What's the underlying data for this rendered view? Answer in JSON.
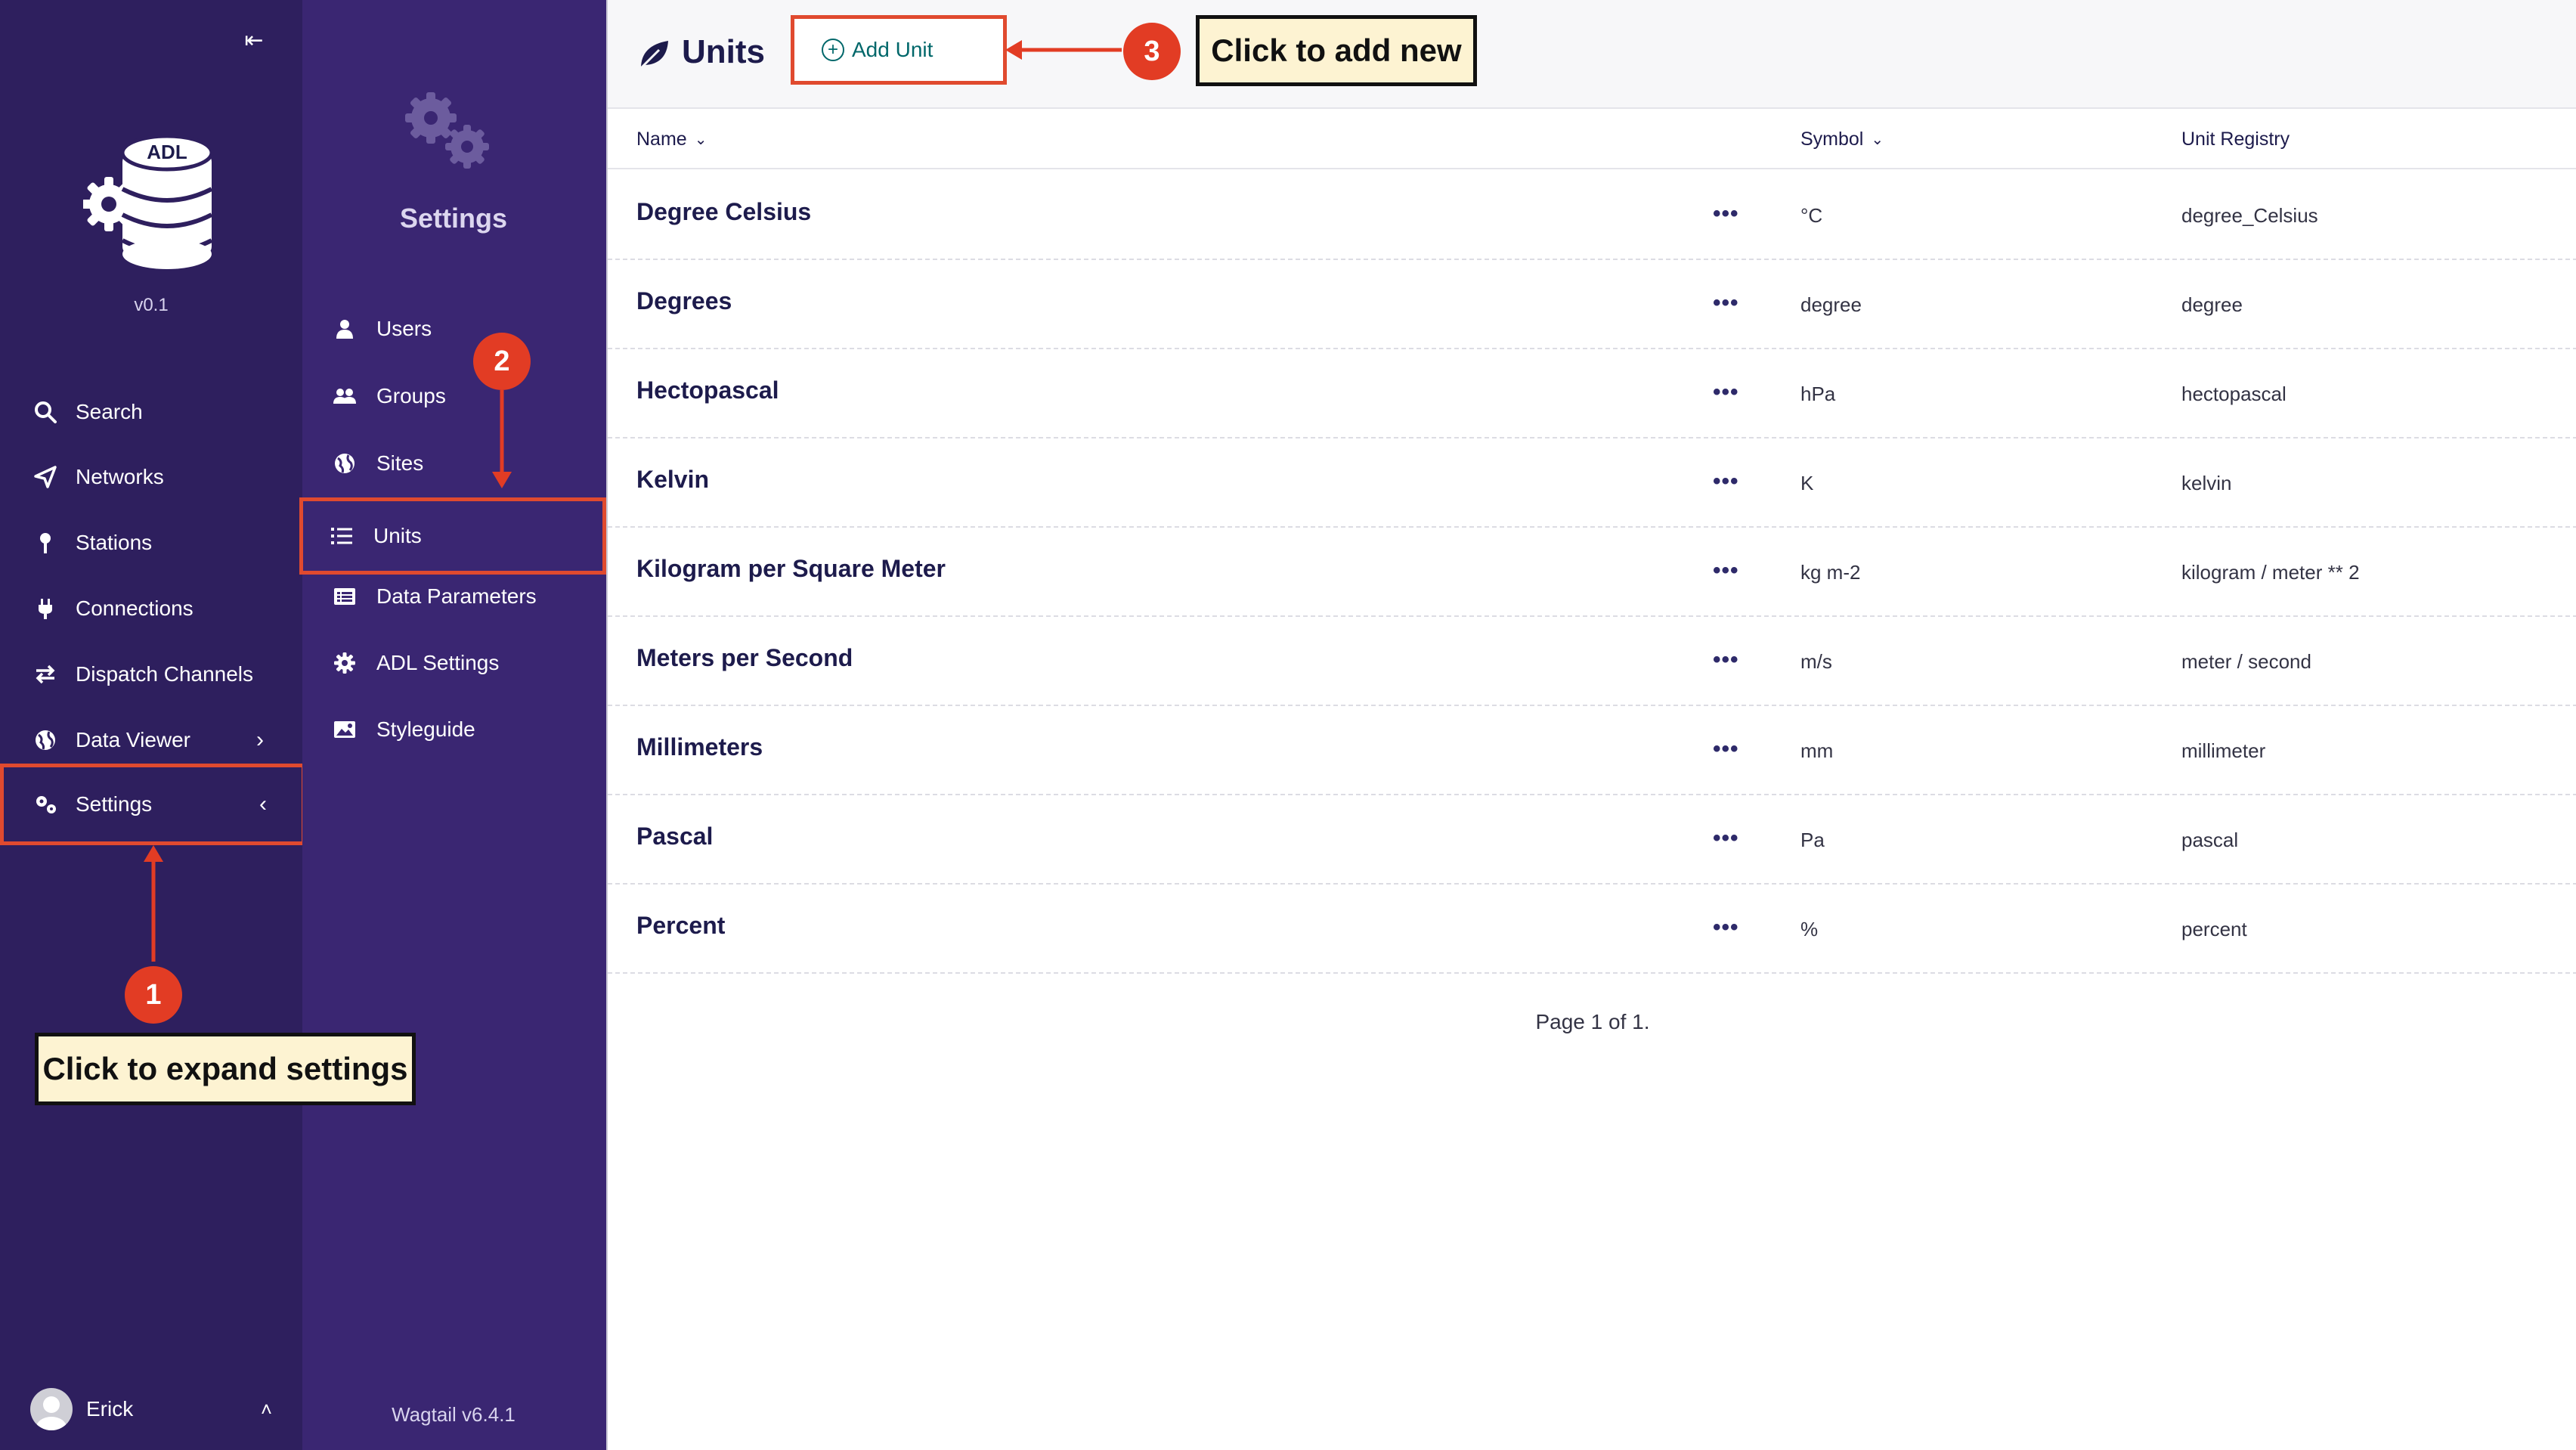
{
  "sidebar": {
    "collapse_label": "⇤",
    "logo_text": "ADL",
    "version": "v0.1",
    "items": [
      {
        "label": "Search",
        "icon": "search-icon"
      },
      {
        "label": "Networks",
        "icon": "paper-plane-icon"
      },
      {
        "label": "Stations",
        "icon": "pin-icon"
      },
      {
        "label": "Connections",
        "icon": "plug-icon"
      },
      {
        "label": "Dispatch Channels",
        "icon": "swap-icon"
      },
      {
        "label": "Data Viewer",
        "icon": "globe-icon",
        "chevron": "›"
      },
      {
        "label": "Settings",
        "icon": "cogs-icon",
        "chevron": "‹"
      }
    ],
    "user": {
      "name": "Erick",
      "chevron": "˄"
    }
  },
  "settings_panel": {
    "title": "Settings",
    "items": [
      {
        "label": "Users",
        "icon": "user-icon"
      },
      {
        "label": "Groups",
        "icon": "group-icon"
      },
      {
        "label": "Sites",
        "icon": "globe-icon"
      },
      {
        "label": "Units",
        "icon": "list-icon"
      },
      {
        "label": "Data Parameters",
        "icon": "table-icon"
      },
      {
        "label": "ADL Settings",
        "icon": "gear-icon"
      },
      {
        "label": "Styleguide",
        "icon": "image-icon"
      }
    ],
    "footer": "Wagtail v6.4.1"
  },
  "header": {
    "title": "Units",
    "add_button": {
      "icon": "+",
      "label": "Add Unit"
    }
  },
  "table": {
    "columns": [
      {
        "label": "Name",
        "sort_icon": "⌄"
      },
      {
        "label": "Symbol",
        "sort_icon": "⌄"
      },
      {
        "label": "Unit Registry"
      }
    ],
    "more_label": "•••",
    "rows": [
      {
        "name": "Degree Celsius",
        "symbol": "°C",
        "registry": "degree_Celsius"
      },
      {
        "name": "Degrees",
        "symbol": "degree",
        "registry": "degree"
      },
      {
        "name": "Hectopascal",
        "symbol": "hPa",
        "registry": "hectopascal"
      },
      {
        "name": "Kelvin",
        "symbol": "K",
        "registry": "kelvin"
      },
      {
        "name": "Kilogram per Square Meter",
        "symbol": "kg m-2",
        "registry": "kilogram / meter ** 2"
      },
      {
        "name": "Meters per Second",
        "symbol": "m/s",
        "registry": "meter / second"
      },
      {
        "name": "Millimeters",
        "symbol": "mm",
        "registry": "millimeter"
      },
      {
        "name": "Pascal",
        "symbol": "Pa",
        "registry": "pascal"
      },
      {
        "name": "Percent",
        "symbol": "%",
        "registry": "percent"
      }
    ]
  },
  "pagination": "Page 1 of 1.",
  "annotations": {
    "step1": {
      "number": "1",
      "text": "Click to expand settings"
    },
    "step2": {
      "number": "2"
    },
    "step3": {
      "number": "3",
      "text": "Click to add new"
    }
  },
  "colors": {
    "sidebar": "#2e1f5e",
    "panel": "#3a2672",
    "highlight": "#e04a2f",
    "badge": "#e23c24",
    "callout": "#fdf3d2",
    "accent": "#00676a"
  }
}
